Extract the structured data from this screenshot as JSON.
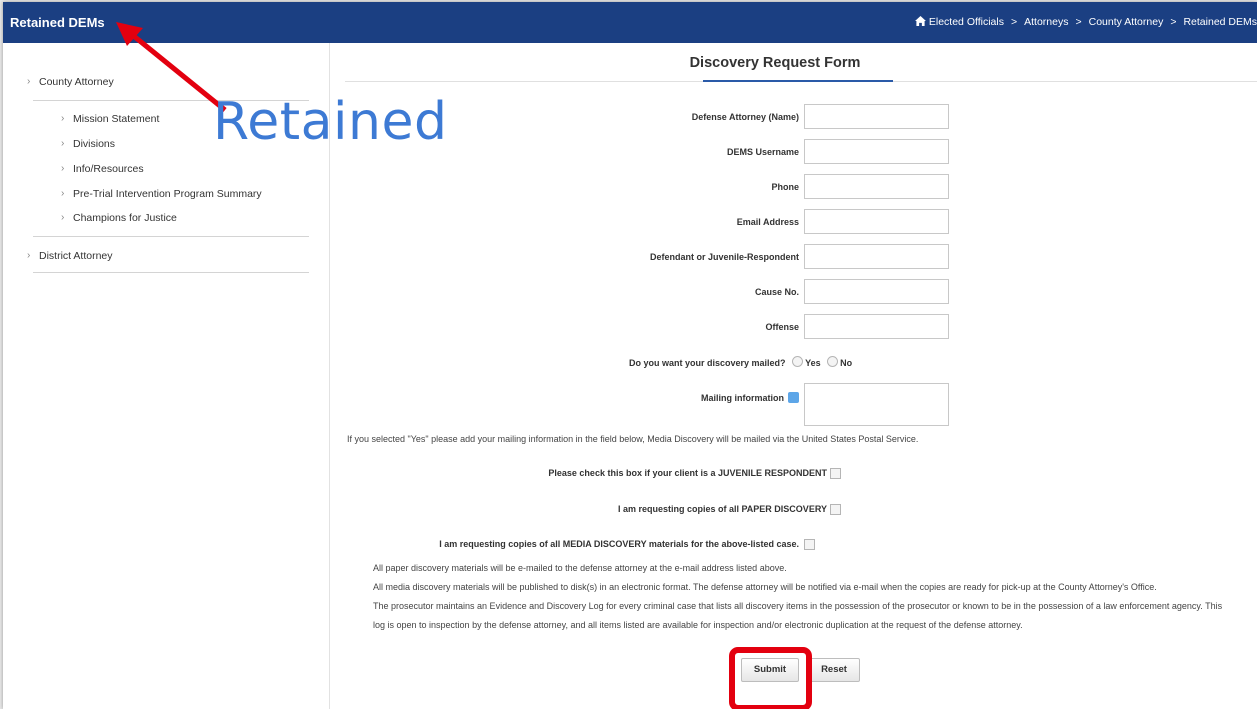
{
  "header": {
    "title": "Retained DEMs",
    "breadcrumbs": [
      "Elected Officials",
      "Attorneys",
      "County Attorney",
      "Retained DEMs"
    ],
    "separator": ">"
  },
  "sidebar": {
    "top_items": [
      "County Attorney",
      "District Attorney"
    ],
    "sub_items": [
      "Mission Statement",
      "Divisions",
      "Info/Resources",
      "Pre-Trial Intervention Program Summary",
      "Champions for Justice"
    ]
  },
  "annotation": {
    "text": "Retained"
  },
  "form": {
    "title": "Discovery Request Form",
    "fields": [
      "Defense Attorney (Name)",
      "DEMS Username",
      "Phone",
      "Email Address",
      "Defendant or Juvenile-Respondent",
      "Cause No.",
      "Offense"
    ],
    "mailed_question": "Do you want your discovery mailed?",
    "yes": "Yes",
    "no": "No",
    "mailing_label": "Mailing information",
    "mailing_note": "If you selected \"Yes\" please add your mailing information in the field below, Media Discovery will be mailed via the United States Postal Service.",
    "checkboxes": [
      "Please check this box if your client is a JUVENILE RESPONDENT",
      "I am requesting copies of all PAPER DISCOVERY",
      "I am requesting copies of all MEDIA DISCOVERY materials for the above-listed case."
    ],
    "notes": [
      "All paper discovery materials will be e-mailed to the defense attorney at the e-mail address listed above.",
      "All media discovery materials will be published to disk(s) in an electronic format. The defense attorney will be notified via e-mail when the copies are ready for pick-up at the County Attorney's Office.",
      "The prosecutor maintains an Evidence and Discovery Log for every criminal case that lists all discovery items in the possession of the prosecutor or known to be in the possession of a law enforcement agency. This log is open to inspection by the defense attorney, and all items listed are available for inspection and/or electronic duplication at the request of the defense attorney."
    ],
    "submit": "Submit",
    "reset": "Reset"
  },
  "colors": {
    "header_bg": "#1b3f82",
    "accent": "#2a5aa8",
    "highlight": "#e3000f",
    "annotation_text": "#3d7ad4"
  }
}
